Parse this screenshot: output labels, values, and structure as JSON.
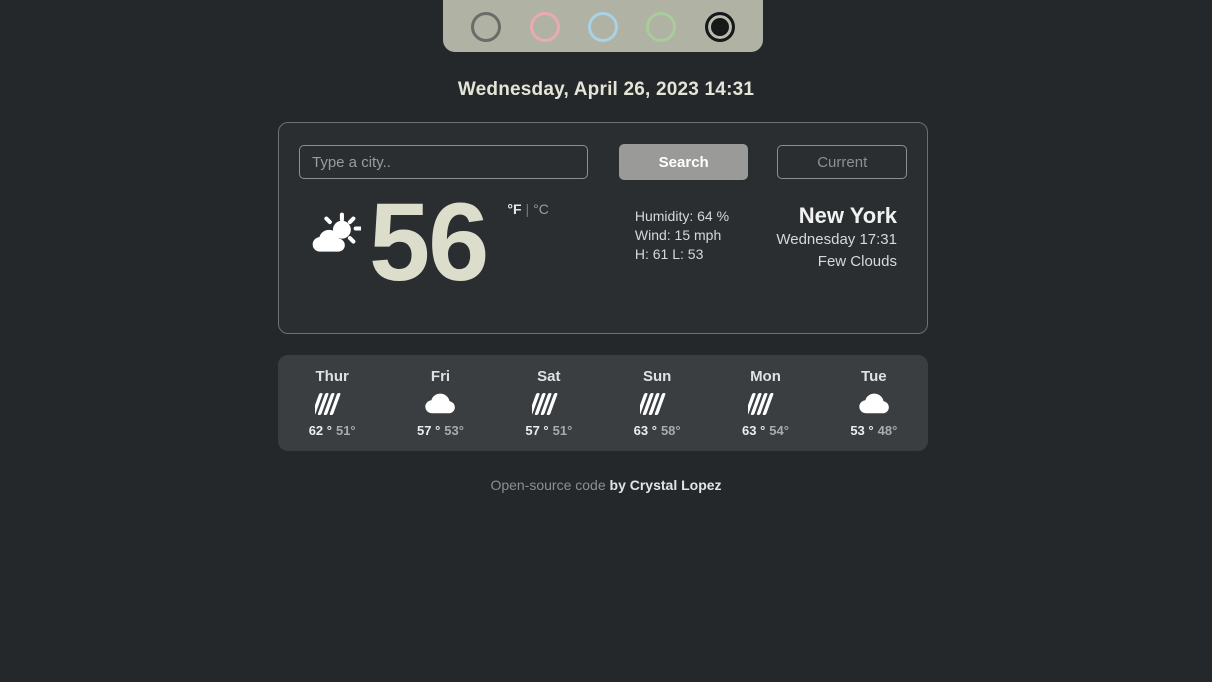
{
  "theme_selector": {
    "swatches": [
      {
        "name": "theme-swatch-gray",
        "color": "#6b6b68",
        "selected": false
      },
      {
        "name": "theme-swatch-pink",
        "color": "#e9aab2",
        "selected": false
      },
      {
        "name": "theme-swatch-blue",
        "color": "#a9d2e4",
        "selected": false
      },
      {
        "name": "theme-swatch-green",
        "color": "#a9cc9a",
        "selected": false
      },
      {
        "name": "theme-swatch-dark",
        "color": "#17181a",
        "selected": true
      }
    ],
    "bar_color": "#b0b2a4"
  },
  "datetime": "Wednesday, April 26, 2023 14:31",
  "search": {
    "placeholder": "Type a city..",
    "value": "",
    "search_label": "Search",
    "current_label": "Current"
  },
  "current": {
    "icon": "sun-behind-cloud-icon",
    "temperature": "56",
    "unit_fahrenheit": "°F",
    "unit_separator": "|",
    "unit_celsius": "°C",
    "active_unit": "°F",
    "humidity": "Humidity: 64 %",
    "wind": "Wind: 15 mph",
    "high_low": "H: 61 L: 53",
    "city": "New York",
    "local_time": "Wednesday 17:31",
    "description": "Few Clouds"
  },
  "forecast": [
    {
      "day": "Thur",
      "icon": "rain-icon",
      "high": "62 °",
      "low": "51°"
    },
    {
      "day": "Fri",
      "icon": "cloud-icon",
      "high": "57 °",
      "low": "53°"
    },
    {
      "day": "Sat",
      "icon": "rain-icon",
      "high": "57 °",
      "low": "51°"
    },
    {
      "day": "Sun",
      "icon": "rain-icon",
      "high": "63 °",
      "low": "58°"
    },
    {
      "day": "Mon",
      "icon": "rain-icon",
      "high": "63 °",
      "low": "54°"
    },
    {
      "day": "Tue",
      "icon": "cloud-icon",
      "high": "53 °",
      "low": "48°"
    }
  ],
  "footer": {
    "text": "Open-source code",
    "author": "by Crystal Lopez"
  }
}
